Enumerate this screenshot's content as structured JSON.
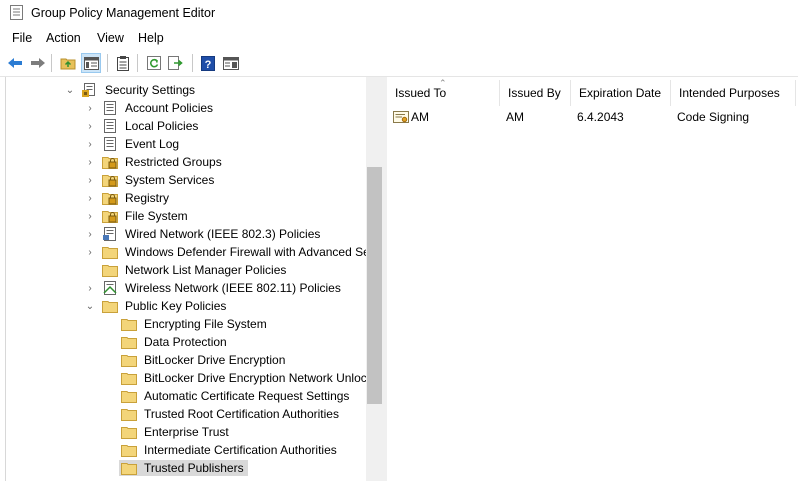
{
  "window": {
    "title": "Group Policy Management Editor"
  },
  "menu": {
    "items": [
      "File",
      "Action",
      "View",
      "Help"
    ]
  },
  "toolbar": {
    "buttons": [
      "back-icon",
      "forward-icon",
      "up-folder-icon",
      "show-hide-tree-icon",
      "properties-icon",
      "refresh-icon",
      "export-list-icon",
      "help-icon",
      "show-action-pane-icon"
    ]
  },
  "tree": {
    "items": [
      {
        "label": "Security Settings",
        "expanded": true,
        "icon": "security-settings-icon"
      },
      {
        "label": "Account Policies",
        "icon": "policy-doc-icon"
      },
      {
        "label": "Local Policies",
        "icon": "policy-doc-icon"
      },
      {
        "label": "Event Log",
        "icon": "policy-doc-icon"
      },
      {
        "label": "Restricted Groups",
        "icon": "locked-folder-icon"
      },
      {
        "label": "System Services",
        "icon": "locked-folder-icon"
      },
      {
        "label": "Registry",
        "icon": "locked-folder-icon"
      },
      {
        "label": "File System",
        "icon": "locked-folder-icon"
      },
      {
        "label": "Wired Network (IEEE 802.3) Policies",
        "icon": "network-policy-icon"
      },
      {
        "label": "Windows Defender Firewall with Advanced Se",
        "icon": "folder-icon"
      },
      {
        "label": "Network List Manager Policies",
        "icon": "folder-icon"
      },
      {
        "label": "Wireless Network (IEEE 802.11) Policies",
        "icon": "wireless-policy-icon"
      },
      {
        "label": "Public Key Policies",
        "expanded": true,
        "icon": "folder-icon"
      },
      {
        "label": "Encrypting File System",
        "icon": "folder-icon"
      },
      {
        "label": "Data Protection",
        "icon": "folder-icon"
      },
      {
        "label": "BitLocker Drive Encryption",
        "icon": "folder-icon"
      },
      {
        "label": "BitLocker Drive Encryption Network Unlocl",
        "icon": "folder-icon"
      },
      {
        "label": "Automatic Certificate Request Settings",
        "icon": "folder-icon"
      },
      {
        "label": "Trusted Root Certification Authorities",
        "icon": "folder-icon"
      },
      {
        "label": "Enterprise Trust",
        "icon": "folder-icon"
      },
      {
        "label": "Intermediate Certification Authorities",
        "icon": "folder-icon"
      },
      {
        "label": "Trusted Publishers",
        "selected": true,
        "icon": "folder-icon"
      }
    ]
  },
  "list": {
    "columns": [
      "Issued To",
      "Issued By",
      "Expiration Date",
      "Intended Purposes"
    ],
    "sorted_column": "Issued To",
    "rows": [
      {
        "issued_to": "AM",
        "issued_by": "AM",
        "expiration": "6.4.2043",
        "purposes": "Code Signing",
        "icon": "certificate-icon"
      }
    ]
  }
}
